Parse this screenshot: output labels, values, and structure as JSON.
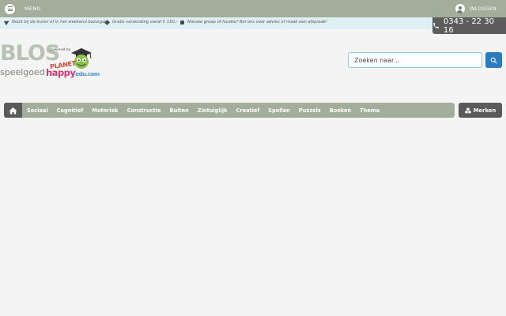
{
  "header": {
    "menu_label": "MENU",
    "login_label": "INLOGGEN"
  },
  "usps": [
    {
      "icon": "paper-plane-icon",
      "text": "Nooit bij de buren of in het weekend bezorgd"
    },
    {
      "icon": "diamond-icon",
      "text": "Gratis verzending vanaf € 150,-"
    },
    {
      "icon": "calendar-icon",
      "text": "Nieuwe groep of locatie? Bel ons voor advies of maak een afspraak!"
    }
  ],
  "phone": "0343 - 22 30 16",
  "logo": {
    "blos": "BLOS",
    "speelgoed": "speelgoed",
    "powered_by": "powered by",
    "planet": "PLANET",
    "happy": "happy",
    "edu": "edu.com"
  },
  "search": {
    "placeholder": "Zoeken naar..."
  },
  "nav": {
    "items": [
      "Sociaal",
      "Cognitief",
      "Motoriek",
      "Constructie",
      "Buiten",
      "Zintuiglijk",
      "Creatief",
      "Spellen",
      "Puzzels",
      "Boeken",
      "Thema"
    ],
    "brands_label": "Merken"
  },
  "colors": {
    "topbar": "#a3ad9c",
    "infobar": "#dff0f5",
    "dark": "#595a59",
    "search_button": "#2d7bbf"
  }
}
